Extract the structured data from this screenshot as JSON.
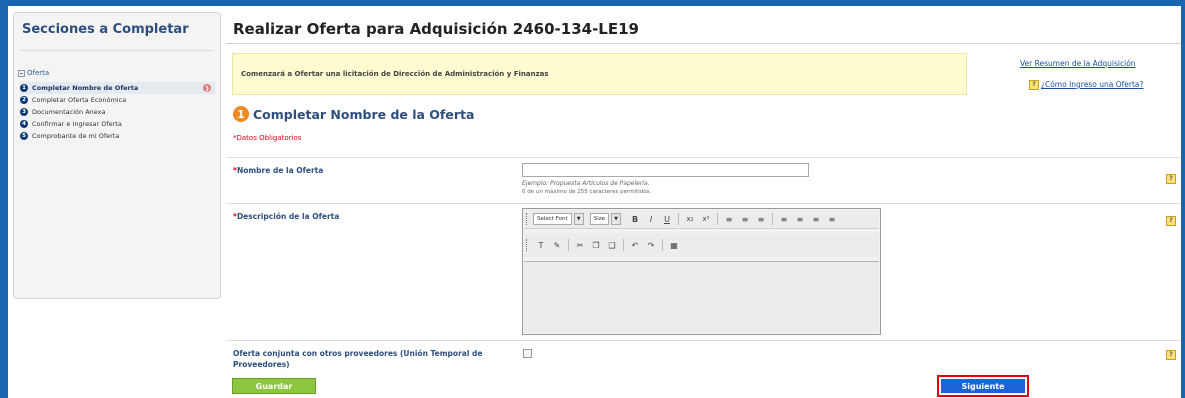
{
  "sidebar": {
    "title": "Secciones a Completar",
    "root_label": "Oferta",
    "steps": [
      {
        "num": "1",
        "label": "Completar Nombre de Oferta"
      },
      {
        "num": "2",
        "label": "Completar Oferta Económica"
      },
      {
        "num": "3",
        "label": "Documentación Anexa"
      },
      {
        "num": "4",
        "label": "Confirmar e Ingresar Oferta"
      },
      {
        "num": "5",
        "label": "Comprobante de mi Oferta"
      }
    ]
  },
  "main": {
    "title": "Realizar Oferta para Adquisición 2460-134-LE19",
    "banner_text": "Comenzará a Ofertar una licitación de Dirección de Administración y Finanzas",
    "link_resumen": "Ver Resumen de la Adquisición",
    "link_como": "¿Cómo Ingreso una Oferta?",
    "section_num": "1",
    "section_title": "Completar Nombre de la Oferta",
    "required_note": "*Datos Obligatorios",
    "help_glyph": "?",
    "fields": {
      "nombre_label": "Nombre de la Oferta",
      "nombre_value": "",
      "nombre_hint": "Ejemplo: Propuesta Artículos de Papelería.",
      "nombre_counter": "0 de un máximo de 255 caracteres permitidos.",
      "descripcion_label": "Descripción de la Oferta",
      "conjunta_label_1": "Oferta conjunta con otros proveedores (Unión Temporal de",
      "conjunta_label_2": "Proveedores)"
    },
    "editor": {
      "font_select": "Select Font",
      "size_select": "Size"
    },
    "buttons": {
      "guardar": "Guardar",
      "siguiente": "Siguiente"
    }
  },
  "colors": {
    "frame": "#1a64b0",
    "accent_green": "#8dc63f",
    "accent_blue": "#1a64d8",
    "highlight_red": "#e0001b"
  }
}
